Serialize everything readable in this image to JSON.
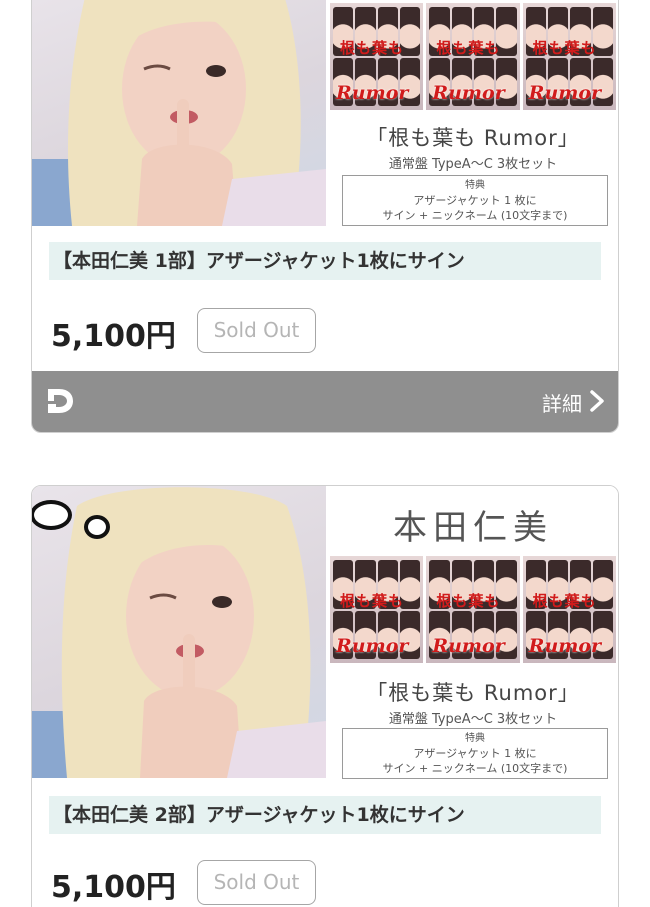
{
  "products": [
    {
      "promo": {
        "song": "「根も葉も Rumor」",
        "sub": "通常盤 TypeA〜C 3枚セット",
        "tokuten": "特典",
        "benefit_line1": "アザージャケット 1 枚に",
        "benefit_line2": "サイン + ニックネーム (10文字まで)",
        "cover_scrawl": "Rumor",
        "cover_scrawl_top": "根も葉も"
      },
      "title": "【本田仁美 1部】アザージャケット1枚にサイン",
      "price": "5,100円",
      "status": "Sold Out",
      "detail_label": "詳細",
      "icons": {
        "logo": "d-logo-icon",
        "arrow": "chevron-right-icon"
      }
    },
    {
      "promo": {
        "member_name": "本田仁美",
        "song": "「根も葉も Rumor」",
        "sub": "通常盤 TypeA〜C 3枚セット",
        "tokuten": "特典",
        "benefit_line1": "アザージャケット 1 枚に",
        "benefit_line2": "サイン + ニックネーム (10文字まで)",
        "cover_scrawl": "Rumor",
        "cover_scrawl_top": "根も葉も"
      },
      "title": "【本田仁美 2部】アザージャケット1枚にサイン",
      "price": "5,100円",
      "status": "Sold Out"
    }
  ],
  "colors": {
    "title_bg": "#e6f2f1",
    "detail_bar": "#8f8f8f",
    "scrawl": "#d11b1b",
    "sold_out_text": "#b5b5b5"
  }
}
